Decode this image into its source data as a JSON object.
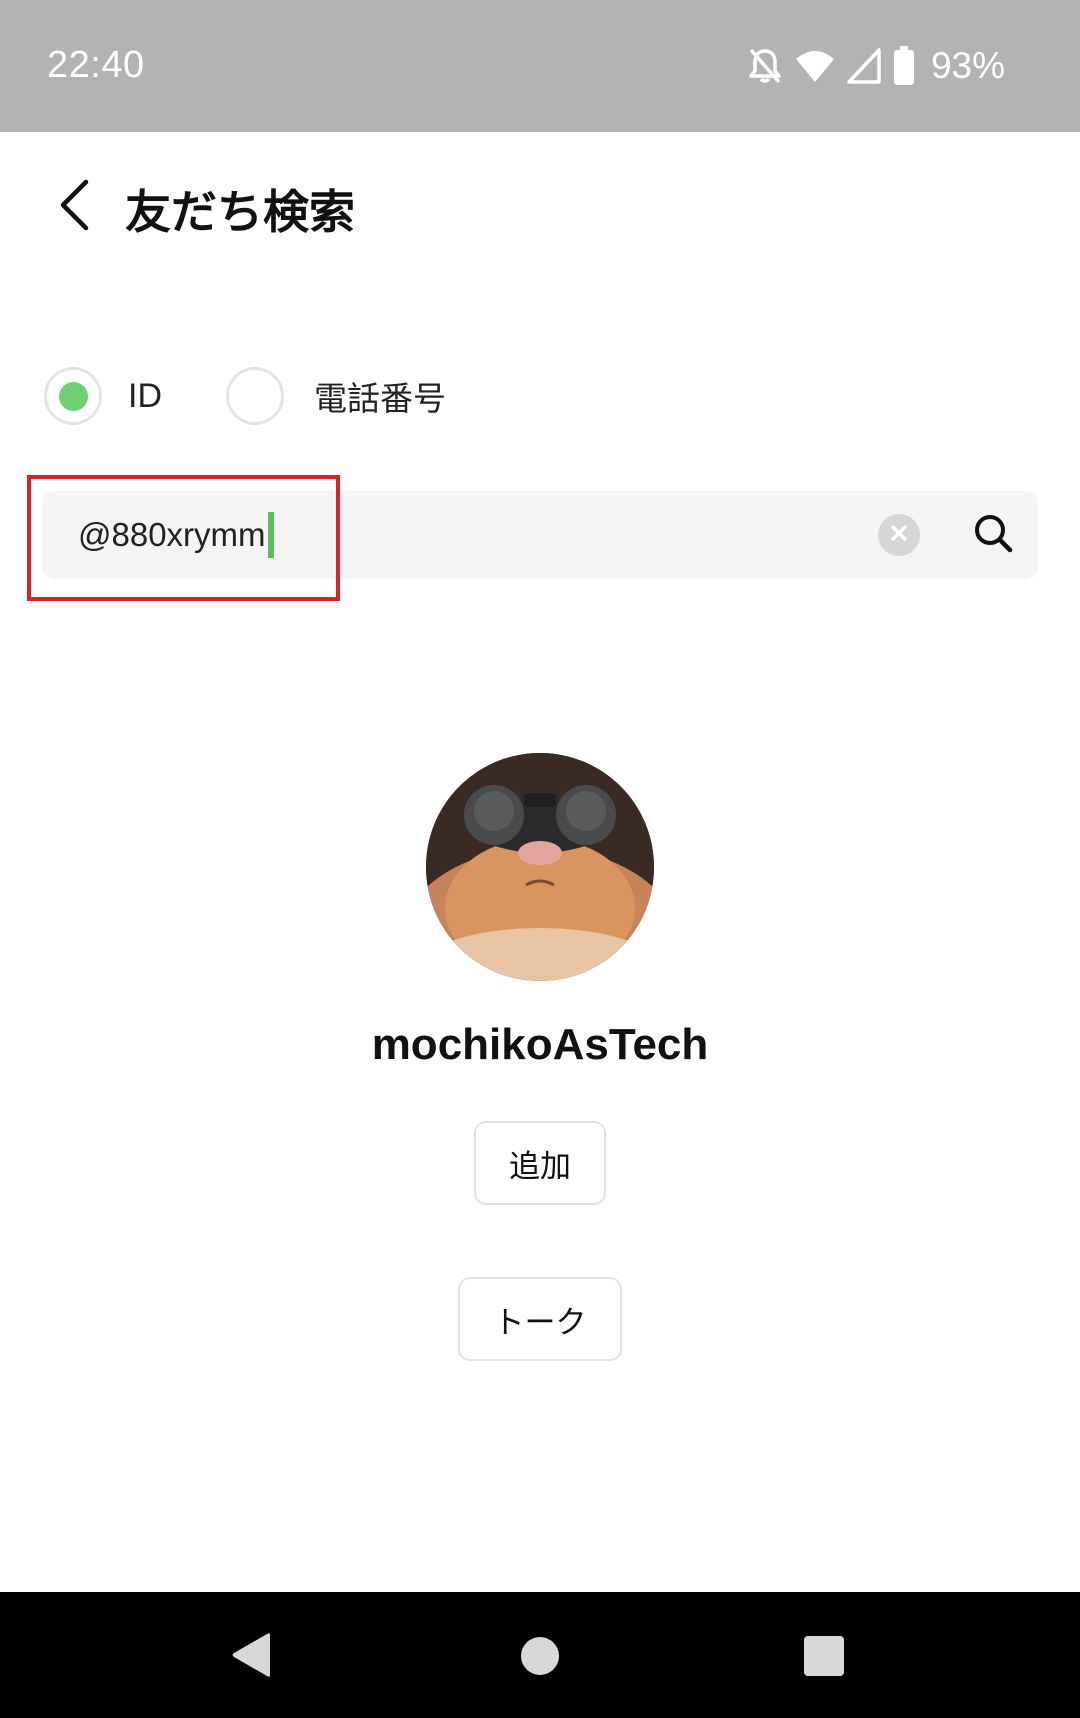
{
  "status_bar": {
    "time": "22:40",
    "battery": "93%",
    "icons": [
      "notifications-off-icon",
      "wifi-icon",
      "cell-signal-icon",
      "battery-icon"
    ]
  },
  "header": {
    "title": "友だち検索"
  },
  "search_type": {
    "options": [
      {
        "label": "ID",
        "selected": true
      },
      {
        "label": "電話番号",
        "selected": false
      }
    ]
  },
  "search": {
    "value": "@880xrymm"
  },
  "profile": {
    "name": "mochikoAsTech",
    "add_label": "追加",
    "talk_label": "トーク"
  },
  "colors": {
    "accent": "#6fcf71",
    "highlight": "#d9202b",
    "status_bar": "#b3b3b3"
  }
}
